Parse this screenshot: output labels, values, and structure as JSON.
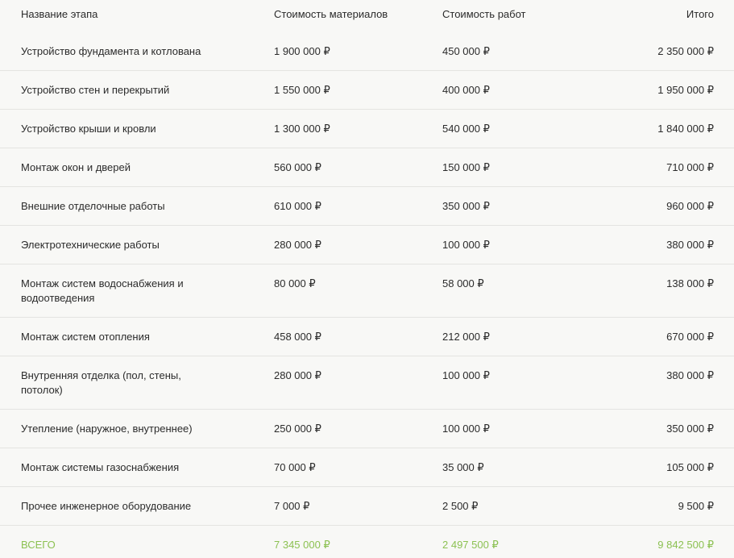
{
  "table": {
    "headers": {
      "stage": "Название этапа",
      "materials": "Стоимость материалов",
      "works": "Стоимость работ",
      "total": "Итого"
    },
    "rows": [
      {
        "stage": "Устройство фундамента и котлована",
        "materials": "1 900 000 ₽",
        "works": "450 000 ₽",
        "total": "2 350 000 ₽"
      },
      {
        "stage": "Устройство стен и перекрытий",
        "materials": "1 550 000 ₽",
        "works": "400 000 ₽",
        "total": "1 950 000 ₽"
      },
      {
        "stage": "Устройство крыши и кровли",
        "materials": "1 300 000 ₽",
        "works": "540 000 ₽",
        "total": "1 840 000 ₽"
      },
      {
        "stage": "Монтаж окон и дверей",
        "materials": "560 000 ₽",
        "works": "150 000 ₽",
        "total": "710 000 ₽"
      },
      {
        "stage": "Внешние отделочные работы",
        "materials": "610 000 ₽",
        "works": "350 000 ₽",
        "total": "960 000 ₽"
      },
      {
        "stage": "Электротехнические работы",
        "materials": "280 000 ₽",
        "works": "100 000 ₽",
        "total": "380 000 ₽"
      },
      {
        "stage": "Монтаж систем водоснабжения и водоотведения",
        "materials": "80 000 ₽",
        "works": "58 000 ₽",
        "total": "138 000 ₽"
      },
      {
        "stage": "Монтаж систем отопления",
        "materials": "458 000 ₽",
        "works": "212 000 ₽",
        "total": "670 000 ₽"
      },
      {
        "stage": "Внутренняя отделка (пол, стены, потолок)",
        "materials": "280 000 ₽",
        "works": "100 000 ₽",
        "total": "380 000 ₽"
      },
      {
        "stage": "Утепление (наружное, внутреннее)",
        "materials": "250 000 ₽",
        "works": "100 000 ₽",
        "total": "350 000 ₽"
      },
      {
        "stage": "Монтаж системы газоснабжения",
        "materials": "70 000 ₽",
        "works": "35 000 ₽",
        "total": "105 000 ₽"
      },
      {
        "stage": "Прочее инженерное оборудование",
        "materials": "7 000 ₽",
        "works": "2 500 ₽",
        "total": "9 500 ₽"
      }
    ],
    "summary": {
      "stage": "ВСЕГО",
      "materials": "7 345 000 ₽",
      "works": "2 497 500 ₽",
      "total": "9 842 500 ₽"
    }
  },
  "colors": {
    "accent_total": "#8cc152",
    "background": "#f8f8f6",
    "divider": "#e4e4e1",
    "text": "#2b2b2b"
  }
}
